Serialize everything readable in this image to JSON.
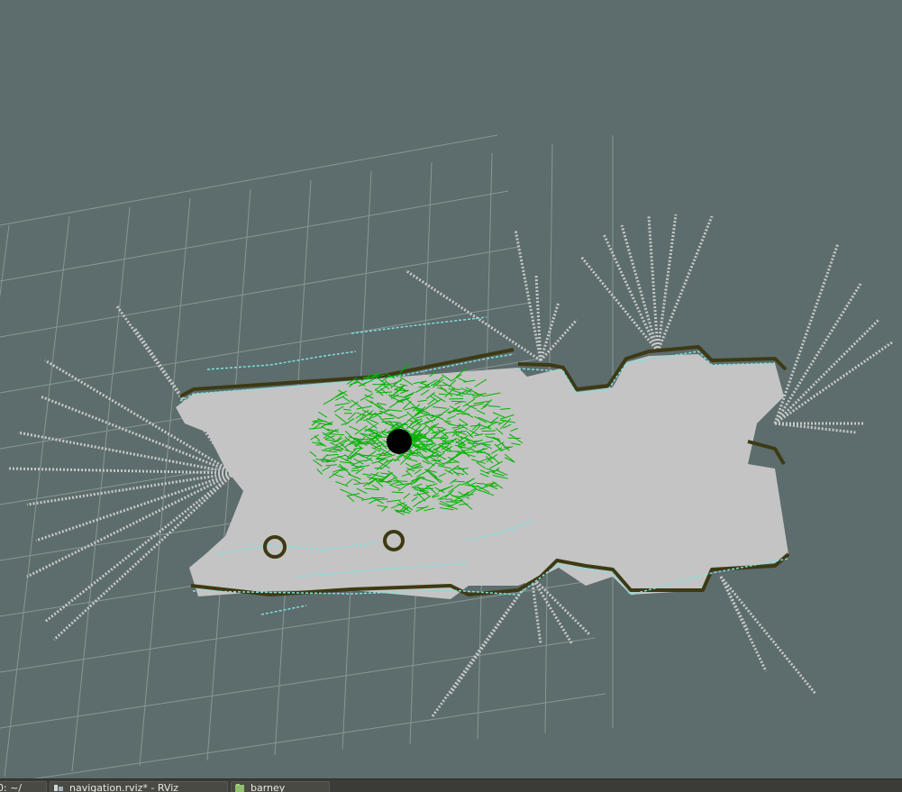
{
  "taskbar": {
    "items": [
      {
        "label": "0: ~/",
        "icon": "terminal-icon"
      },
      {
        "label": "navigation.rviz* - RViz",
        "icon": "rviz-icon"
      },
      {
        "label": "barney",
        "icon": "folder-icon"
      }
    ]
  },
  "scene": {
    "view": "RViz 3D map view",
    "colors": {
      "background": "#5d6c6c",
      "grid": "#8a9696",
      "free_space": "#c4c4c4",
      "obstacle": "#3d3a14",
      "inflation": "#7ee0e0",
      "particles": "#00b400",
      "robot": "#000000"
    }
  }
}
